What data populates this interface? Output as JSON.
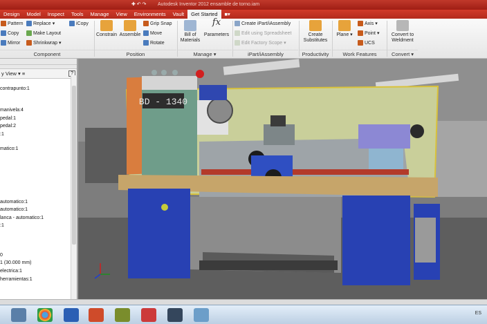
{
  "title": "Autodesk Inventor 2012    ensamble de torno.iam",
  "menu": [
    "Design",
    "Model",
    "Inspect",
    "Tools",
    "Manage",
    "View",
    "Environments",
    "Vault",
    "Get Started"
  ],
  "ribbon": {
    "component": {
      "pattern": "Pattern",
      "replace": "Replace",
      "icopy": "iCopy",
      "copy": "Copy",
      "make_layout": "Make Layout",
      "mirror": "Mirror",
      "shrinkwrap": "Shrinkwrap",
      "label": "Component"
    },
    "position": {
      "constrain": "Constrain",
      "assemble": "Assemble",
      "grip_snap": "Grip Snap",
      "move": "Move",
      "rotate": "Rotate",
      "label": "Position"
    },
    "manage": {
      "bom": "Bill of\nMaterials",
      "parameters": "Parameters",
      "label": "Manage"
    },
    "ipart": {
      "create": "Create iPart/iAssembly",
      "edit_spreadsheet": "Edit using Spreadsheet",
      "edit_factory": "Edit Factory Scope",
      "label": "iPart/iAssembly"
    },
    "productivity": {
      "create_subs": "Create\nSubstitutes",
      "label": "Productivity"
    },
    "work": {
      "plane": "Plane",
      "axis": "Axis",
      "point": "Point",
      "ucs": "UCS",
      "label": "Work Features"
    },
    "convert": {
      "convert": "Convert to\nWeldment",
      "label": "Convert"
    }
  },
  "browser": {
    "view_label": "y View",
    "items": [
      "contrapunto:1",
      "manivela:4",
      "pedal:1",
      "pedal:2",
      ":1",
      "matico:1",
      "automatico:1",
      "automatico:1",
      "lanca - automatico:1",
      ":1",
      "0",
      "1 (30.000 mm)",
      "electrica:1",
      "herramientas:1"
    ]
  },
  "viewport": {
    "machine_label": "BD - 1340"
  },
  "status": {
    "clock": "ES"
  }
}
